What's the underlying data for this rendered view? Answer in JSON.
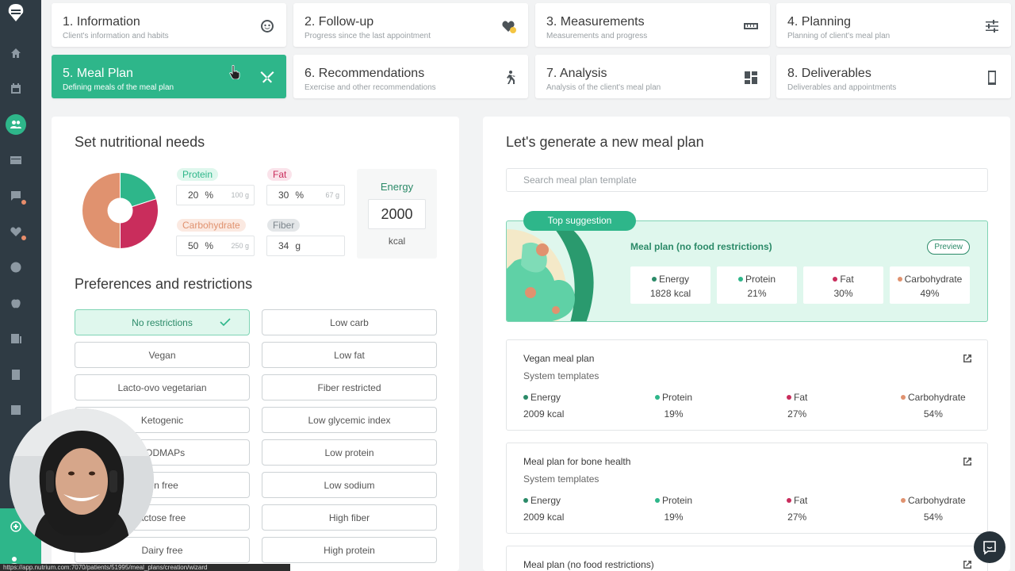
{
  "steps": [
    {
      "title": "1. Information",
      "subtitle": "Client's information and habits",
      "icon": "face-icon"
    },
    {
      "title": "2. Follow-up",
      "subtitle": "Progress since the last appointment",
      "icon": "heart-icon"
    },
    {
      "title": "3. Measurements",
      "subtitle": "Measurements and progress",
      "icon": "ruler-icon"
    },
    {
      "title": "4. Planning",
      "subtitle": "Planning of client's meal plan",
      "icon": "sliders-icon"
    },
    {
      "title": "5. Meal Plan",
      "subtitle": "Defining meals of the meal plan",
      "icon": "utensils-icon"
    },
    {
      "title": "6. Recommendations",
      "subtitle": "Exercise and other recommendations",
      "icon": "running-icon"
    },
    {
      "title": "7. Analysis",
      "subtitle": "Analysis of the client's meal plan",
      "icon": "dashboard-icon"
    },
    {
      "title": "8. Deliverables",
      "subtitle": "Deliverables and appointments",
      "icon": "phone-icon"
    }
  ],
  "nutrition": {
    "title": "Set nutritional needs",
    "protein": {
      "label": "Protein",
      "percent": "20",
      "unit": "%",
      "grams": "100 g",
      "pie_fraction": 0.2
    },
    "fat": {
      "label": "Fat",
      "percent": "30",
      "unit": "%",
      "grams": "67 g",
      "pie_fraction": 0.3
    },
    "carbohydrate": {
      "label": "Carbohydrate",
      "percent": "50",
      "unit": "%",
      "grams": "250 g",
      "pie_fraction": 0.5
    },
    "fiber": {
      "label": "Fiber",
      "value": "34",
      "unit": "g"
    },
    "energy": {
      "label": "Energy",
      "value": "2000",
      "unit": "kcal"
    }
  },
  "preferences": {
    "title": "Preferences and restrictions",
    "left": [
      "No restrictions",
      "Vegan",
      "Lacto-ovo vegetarian",
      "Ketogenic",
      "FODMAPs",
      "ten free",
      "actose free",
      "Dairy free"
    ],
    "right": [
      "Low carb",
      "Low fat",
      "Fiber restricted",
      "Low glycemic index",
      "Low protein",
      "Low sodium",
      "High fiber",
      "High protein"
    ]
  },
  "mealplan": {
    "title": "Let's generate a new meal plan",
    "search_placeholder": "Search meal plan template",
    "top_label": "Top suggestion",
    "top": {
      "name": "Meal plan (no food restrictions)",
      "preview": "Preview",
      "stats": [
        {
          "label": "Energy",
          "value": "1828 kcal"
        },
        {
          "label": "Protein",
          "value": "21%"
        },
        {
          "label": "Fat",
          "value": "30%"
        },
        {
          "label": "Carbohydrate",
          "value": "49%"
        }
      ]
    },
    "plans": [
      {
        "name": "Vegan meal plan",
        "source": "System templates",
        "stats": [
          {
            "label": "Energy",
            "value": "2009 kcal"
          },
          {
            "label": "Protein",
            "value": "19%"
          },
          {
            "label": "Fat",
            "value": "27%"
          },
          {
            "label": "Carbohydrate",
            "value": "54%"
          }
        ]
      },
      {
        "name": "Meal plan for bone health",
        "source": "System templates",
        "stats": [
          {
            "label": "Energy",
            "value": "2009 kcal"
          },
          {
            "label": "Protein",
            "value": "19%"
          },
          {
            "label": "Fat",
            "value": "27%"
          },
          {
            "label": "Carbohydrate",
            "value": "54%"
          }
        ]
      },
      {
        "name": "Meal plan (no food restrictions)"
      }
    ]
  },
  "colors": {
    "accent": "#2eb68a",
    "protein": "#2eb68a",
    "fat": "#c92d5c",
    "carbohydrate": "#e0926f",
    "fiber": "#9aa3ab",
    "sidebar": "#2f3b44"
  },
  "status_url": "https://app.nutrium.com:7070/patients/51995/meal_plans/creation/wizard"
}
